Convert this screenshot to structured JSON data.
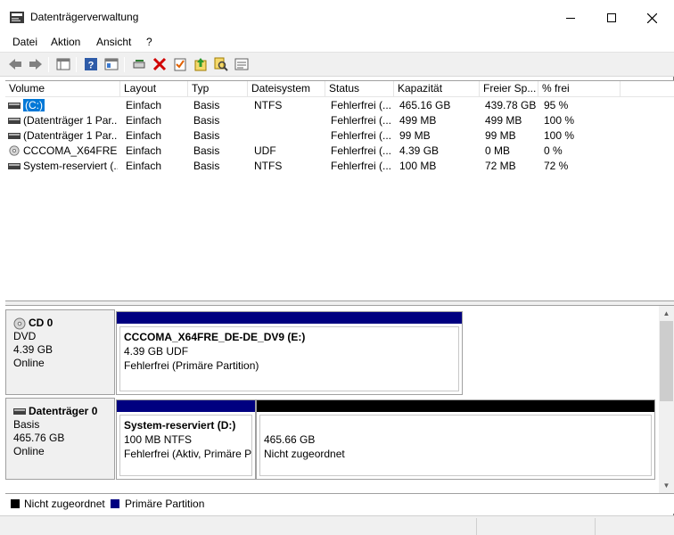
{
  "window": {
    "title": "Datenträgerverwaltung",
    "min_label": "—",
    "max_label": "☐",
    "close_label": "✕"
  },
  "menu": [
    "Datei",
    "Aktion",
    "Ansicht",
    "?"
  ],
  "toolbar": [
    "back-icon",
    "forward-icon",
    "console-tree-icon",
    "help-icon",
    "properties-icon",
    "connect-icon",
    "delete-icon",
    "check-icon",
    "upload-icon",
    "search-icon",
    "list-icon"
  ],
  "volume_list": {
    "columns": [
      "Volume",
      "Layout",
      "Typ",
      "Dateisystem",
      "Status",
      "Kapazität",
      "Freier Sp...",
      "% frei"
    ],
    "rows": [
      [
        "(C:)",
        "Einfach",
        "Basis",
        "NTFS",
        "Fehlerfrei (...",
        "465.16 GB",
        "439.78 GB",
        "95 %"
      ],
      [
        "(Datenträger 1 Par...",
        "Einfach",
        "Basis",
        "",
        "Fehlerfrei (...",
        "499 MB",
        "499 MB",
        "100 %"
      ],
      [
        "(Datenträger 1 Par...",
        "Einfach",
        "Basis",
        "",
        "Fehlerfrei (...",
        "99 MB",
        "99 MB",
        "100 %"
      ],
      [
        "CCCOMA_X64FRE...",
        "Einfach",
        "Basis",
        "UDF",
        "Fehlerfrei (...",
        "4.39 GB",
        "0 MB",
        "0 %"
      ],
      [
        "System-reserviert (...",
        "Einfach",
        "Basis",
        "NTFS",
        "Fehlerfrei (...",
        "100 MB",
        "72 MB",
        "72 %"
      ]
    ],
    "row_icons": [
      "drive-icon",
      "drive-icon",
      "drive-icon",
      "cd-icon",
      "drive-icon"
    ]
  },
  "disks": {
    "cd0": {
      "name": "CD 0",
      "type": "DVD",
      "size": "4.39 GB",
      "state": "Online",
      "partition": {
        "name": "CCCOMA_X64FRE_DE-DE_DV9  (E:)",
        "size": "4.39 GB UDF",
        "status": "Fehlerfrei (Primäre Partition)"
      }
    },
    "disk0": {
      "name": "Datenträger 0",
      "type": "Basis",
      "size": "465.76 GB",
      "state": "Online",
      "partitions": [
        {
          "name": "System-reserviert  (D:)",
          "size": "100 MB NTFS",
          "status": "Fehlerfrei (Aktiv, Primäre P"
        },
        {
          "size": "465.66 GB",
          "status": "Nicht zugeordnet"
        }
      ]
    }
  },
  "legend": [
    {
      "label": "Nicht zugeordnet",
      "color": "#000000"
    },
    {
      "label": "Primäre Partition",
      "color": "#000080"
    }
  ],
  "colors": {
    "primary_bar": "#000080",
    "unallocated_bar": "#000000",
    "selection": "#0078d7"
  }
}
